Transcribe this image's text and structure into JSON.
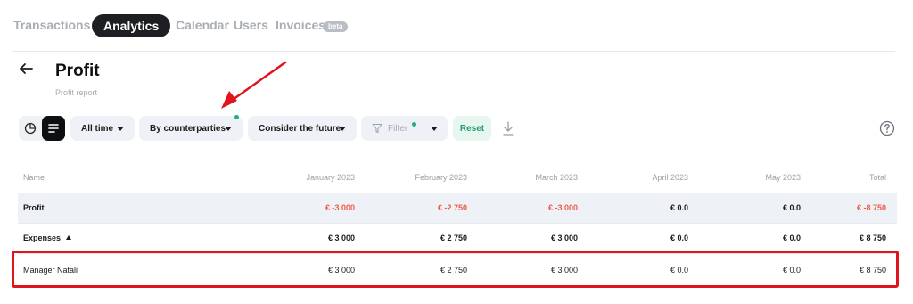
{
  "nav": {
    "tabs": [
      {
        "label": "Transactions",
        "active": false
      },
      {
        "label": "Analytics",
        "active": true
      },
      {
        "label": "Calendar",
        "active": false
      },
      {
        "label": "Users",
        "active": false
      },
      {
        "label": "Invoices",
        "active": false
      }
    ],
    "beta_badge": "beta"
  },
  "header": {
    "title": "Profit",
    "subtitle": "Profit report"
  },
  "toolbar": {
    "period": "All time",
    "grouping": "By counterparties",
    "future": "Consider the future",
    "filter": "Filter",
    "reset": "Reset"
  },
  "table": {
    "columns": [
      "Name",
      "January 2023",
      "February 2023",
      "March 2023",
      "April 2023",
      "May 2023",
      "Total"
    ],
    "rows": [
      {
        "name": "Profit",
        "values": [
          "€ -3 000",
          "€ -2 750",
          "€ -3 000",
          "€ 0.0",
          "€ 0.0",
          "€ -8 750"
        ]
      },
      {
        "name": "Expenses",
        "values": [
          "€ 3 000",
          "€ 2 750",
          "€ 3 000",
          "€ 0.0",
          "€ 0.0",
          "€ 8 750"
        ]
      },
      {
        "name": "Manager Natali",
        "values": [
          "€ 3 000",
          "€ 2 750",
          "€ 3 000",
          "€ 0.0",
          "€ 0.0",
          "€ 8 750"
        ]
      }
    ]
  },
  "colors": {
    "accent_dark": "#1e1f22",
    "negative": "#f05a46",
    "positive_green": "#1f9e6c",
    "annotation_red": "#e0141d"
  },
  "icons": [
    "back-arrow-icon",
    "pie-chart-icon",
    "list-view-icon",
    "filter-funnel-icon",
    "download-icon",
    "help-icon"
  ]
}
